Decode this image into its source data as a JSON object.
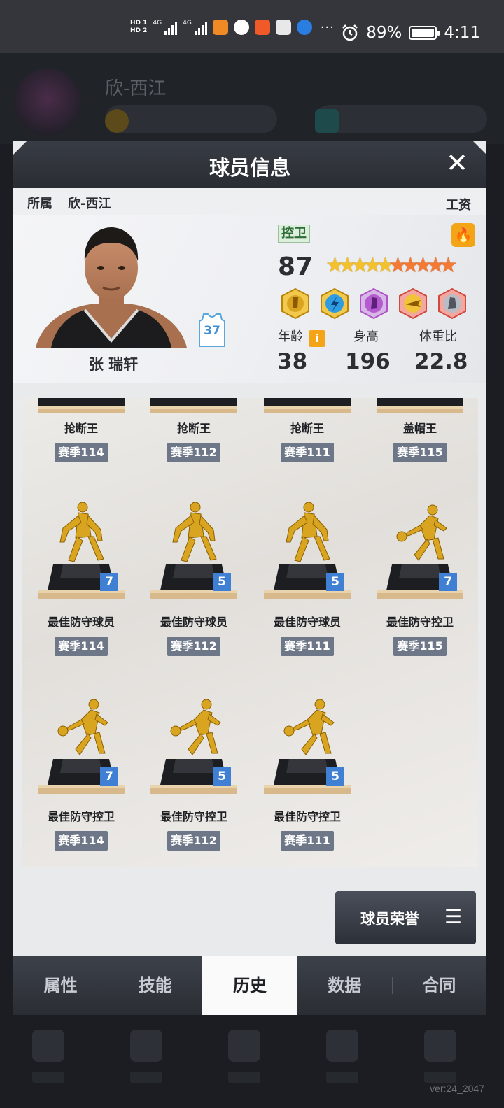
{
  "status_bar": {
    "hd1": "HD 1",
    "hd2": "HD 2",
    "net1": "4G",
    "net2": "4G",
    "battery": "89%",
    "time": "4:11"
  },
  "background": {
    "team_name": "欣-西江",
    "version": "ver:24_2047"
  },
  "modal": {
    "title": "球员信息",
    "close_icon": "close-icon",
    "team_label": "所属",
    "team_value": "欣-西江",
    "salary_label": "工资"
  },
  "player": {
    "name": "张 瑞轩",
    "jersey_number": "37",
    "position": "控卫",
    "rating": "87",
    "stars_gold": 5,
    "stars_orange": 5,
    "badges": [
      "gold-badge",
      "blue-badge",
      "purple-badge",
      "gold-wing-badge",
      "red-badge"
    ],
    "age_label": "年龄",
    "age": "38",
    "height_label": "身高",
    "height": "196",
    "weight_label": "体重比",
    "weight": "22.8"
  },
  "trophies": {
    "top_row": [
      {
        "name": "抢断王",
        "season": "赛季114"
      },
      {
        "name": "抢断王",
        "season": "赛季112"
      },
      {
        "name": "抢断王",
        "season": "赛季111"
      },
      {
        "name": "盖帽王",
        "season": "赛季115"
      }
    ],
    "row2": [
      {
        "name": "最佳防守球员",
        "season": "赛季114",
        "count": "7"
      },
      {
        "name": "最佳防守球员",
        "season": "赛季112",
        "count": "5"
      },
      {
        "name": "最佳防守球员",
        "season": "赛季111",
        "count": "5"
      },
      {
        "name": "最佳防守控卫",
        "season": "赛季115",
        "count": "7"
      }
    ],
    "row3": [
      {
        "name": "最佳防守控卫",
        "season": "赛季114",
        "count": "7"
      },
      {
        "name": "最佳防守控卫",
        "season": "赛季112",
        "count": "5"
      },
      {
        "name": "最佳防守控卫",
        "season": "赛季111",
        "count": "5"
      }
    ]
  },
  "honor_button": {
    "label": "球员荣誉",
    "icon": "menu-icon"
  },
  "tabs": [
    {
      "label": "属性",
      "active": false
    },
    {
      "label": "技能",
      "active": false
    },
    {
      "label": "历史",
      "active": true
    },
    {
      "label": "数据",
      "active": false
    },
    {
      "label": "合同",
      "active": false
    }
  ],
  "colors": {
    "accent_blue": "#3f7fd4",
    "season_tag": "#6d7787",
    "position_green": "#2e6b37",
    "fire_orange": "#f3a417"
  }
}
